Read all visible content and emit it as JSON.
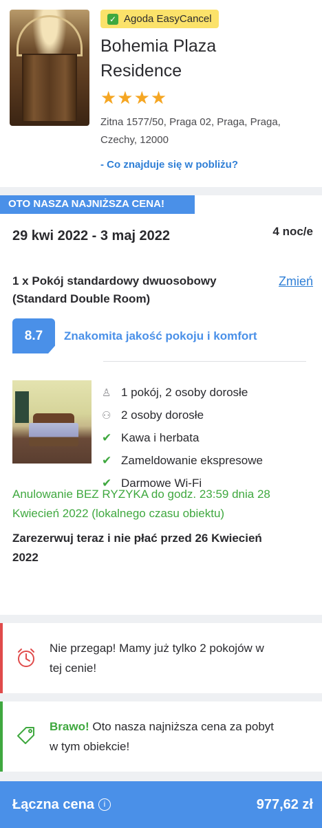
{
  "hotel": {
    "badge": "Agoda EasyCancel",
    "name_line1": "Bohemia Plaza",
    "name_line2": "Residence",
    "stars": "★★★★",
    "rating_stars": 4,
    "address_line1": "Zitna 1577/50, Praga 02, Praga, Praga,",
    "address_line2": "Czechy, 12000",
    "nearby_link": "- Co znajduje się w pobliżu?"
  },
  "booking": {
    "tag": "OTO NASZA NAJNIŻSZA CENA!",
    "dates": "29 kwi 2022 - 3 maj 2022",
    "nights": "4 noc/e",
    "room_line1": "1 x Pokój standardowy dwuosobowy",
    "room_line2": "(Standard Double Room)",
    "change_link": "Zmień",
    "score": "8.7",
    "score_text": "Znakomita jakość pokoju i komfort",
    "features": [
      {
        "icon": "person-icon",
        "glyph": "♙",
        "label": "1 pokój, 2 osoby dorosłe"
      },
      {
        "icon": "group-icon",
        "glyph": "⚇",
        "label": "2 osoby dorosłe"
      },
      {
        "icon": "check-icon",
        "glyph": "✔",
        "label": "Kawa i herbata"
      },
      {
        "icon": "check-icon",
        "glyph": "✔",
        "label": "Zameldowanie ekspresowe"
      },
      {
        "icon": "check-icon",
        "glyph": "✔",
        "label": "Darmowe Wi-Fi"
      }
    ],
    "cancel_line1": "Anulowanie BEZ RYZYKA do godz. 23:59 dnia 28",
    "cancel_line2": "Kwiecień 2022 (lokalnego czasu obiektu)",
    "pay_line1": "Zarezerwuj teraz i nie płać przed 26 Kwiecień",
    "pay_line2": "2022"
  },
  "alerts": {
    "urgency_line1": "Nie przegap! Mamy już tylko 2 pokojów w",
    "urgency_line2": "tej cenie!",
    "deal_strong": "Brawo!",
    "deal_line1": " Oto nasza najniższa cena za pobyt",
    "deal_line2": "w tym obiekcie!"
  },
  "total": {
    "label": "Łączna cena",
    "info": "i",
    "price": "977,62 zł"
  },
  "colors": {
    "accent": "#4a90e8",
    "badge": "#fbe26a",
    "success": "#3fa83f",
    "urgent": "#e04b4b",
    "star": "#f5a623"
  }
}
